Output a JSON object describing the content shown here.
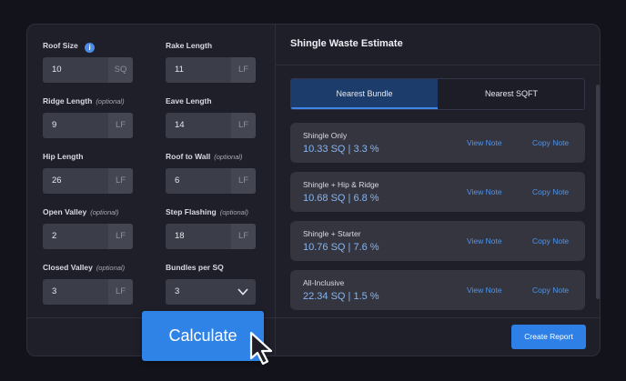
{
  "form": {
    "fields": [
      {
        "label": "Roof Size",
        "optional": "",
        "value": "10",
        "unit": "SQ",
        "info": "i"
      },
      {
        "label": "Rake Length",
        "optional": "",
        "value": "11",
        "unit": "LF"
      },
      {
        "label": "Ridge Length",
        "optional": "(optional)",
        "value": "9",
        "unit": "LF"
      },
      {
        "label": "Eave Length",
        "optional": "",
        "value": "14",
        "unit": "LF"
      },
      {
        "label": "Hip Length",
        "optional": "",
        "value": "26",
        "unit": "LF"
      },
      {
        "label": "Roof to Wall",
        "optional": "(optional)",
        "value": "6",
        "unit": "LF"
      },
      {
        "label": "Open Valley",
        "optional": "(optional)",
        "value": "2",
        "unit": "LF"
      },
      {
        "label": "Step Flashing",
        "optional": "(optional)",
        "value": "18",
        "unit": "LF"
      },
      {
        "label": "Closed Valley",
        "optional": "(optional)",
        "value": "3",
        "unit": "LF"
      },
      {
        "label": "Bundles per SQ",
        "optional": "",
        "value": "3",
        "icon": "chevron-down-icon"
      }
    ],
    "calculate_label": "Calculate"
  },
  "estimate": {
    "title": "Shingle Waste Estimate",
    "tabs": [
      {
        "label": "Nearest Bundle",
        "active": true
      },
      {
        "label": "Nearest SQFT",
        "active": false
      }
    ],
    "results": [
      {
        "name": "Shingle Only",
        "value": "10.33 SQ | 3.3 %",
        "view": "View Note",
        "copy": "Copy Note"
      },
      {
        "name": "Shingle + Hip & Ridge",
        "value": "10.68 SQ | 6.8 %",
        "view": "View Note",
        "copy": "Copy Note"
      },
      {
        "name": "Shingle + Starter",
        "value": "10.76 SQ | 7.6 %",
        "view": "View Note",
        "copy": "Copy Note"
      },
      {
        "name": "All-Inclusive",
        "value": "22.34 SQ | 1.5 %",
        "view": "View Note",
        "copy": "Copy Note"
      }
    ],
    "create_report_label": "Create Report"
  },
  "colors": {
    "background": "#13141b",
    "panel": "#1e1f29",
    "accent": "#2f83e7",
    "result_value": "#86b5f2",
    "link": "#4f94ea"
  }
}
